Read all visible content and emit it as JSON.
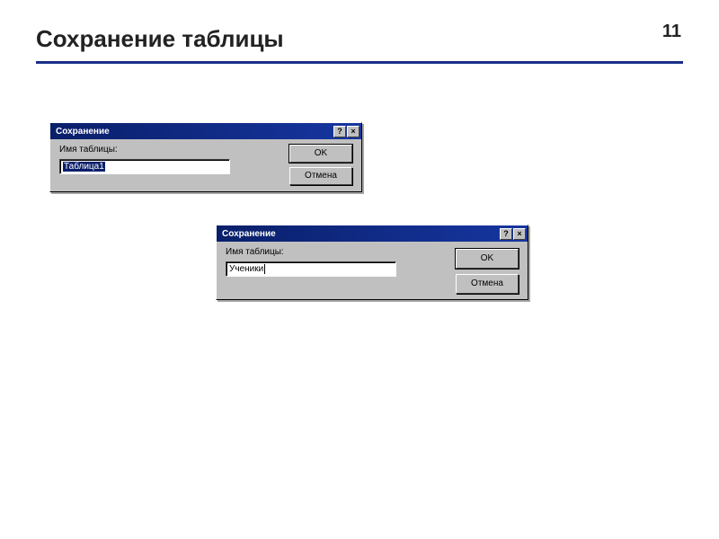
{
  "page": {
    "title": "Сохранение таблицы",
    "number": "11"
  },
  "dialogs": {
    "d1": {
      "title": "Сохранение",
      "help_glyph": "?",
      "close_glyph": "×",
      "label": "Имя таблицы:",
      "value": "Таблица1",
      "ok": "OK",
      "cancel": "Отмена"
    },
    "d2": {
      "title": "Сохранение",
      "help_glyph": "?",
      "close_glyph": "×",
      "label": "Имя таблицы:",
      "value": "Ученики",
      "ok": "OK",
      "cancel": "Отмена"
    }
  }
}
